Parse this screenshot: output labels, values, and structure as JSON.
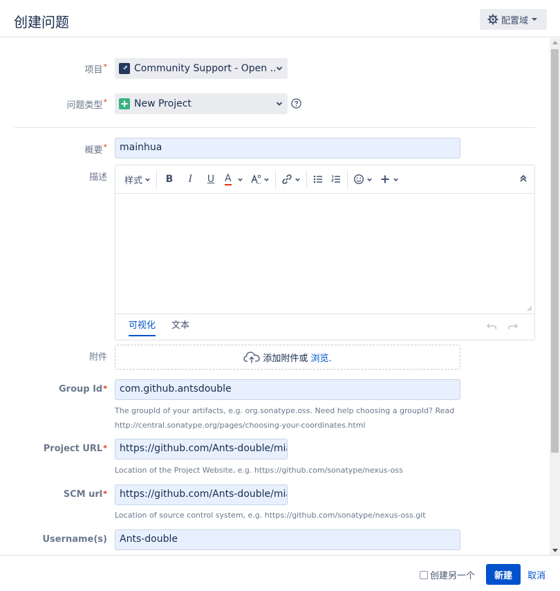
{
  "dialog": {
    "title": "创建问题",
    "config_label": "配置域"
  },
  "form": {
    "project": {
      "label": "项目",
      "value": "Community Support - Open ..."
    },
    "issue_type": {
      "label": "问题类型",
      "value": "New Project"
    },
    "summary": {
      "label": "概要",
      "value": "mainhua"
    },
    "description": {
      "label": "描述",
      "toolbar": {
        "style_label": "样式",
        "bold": "B",
        "italic": "I",
        "underline": "U",
        "color": "A"
      },
      "tabs": [
        "可视化",
        "文本"
      ]
    },
    "attachment": {
      "label": "附件",
      "drop_text": "添加附件或",
      "browse_link": "浏览."
    },
    "group_id": {
      "label": "Group Id",
      "value": "com.github.antsdouble",
      "help_line1": "The groupId of your artifacts, e.g. org.sonatype.oss. Need help choosing a groupId? Read",
      "help_line2": "http://central.sonatype.org/pages/choosing-your-coordinates.html"
    },
    "project_url": {
      "label": "Project URL",
      "value": "https://github.com/Ants-double/mianh",
      "help": "Location of the Project Website, e.g. https://github.com/sonatype/nexus-oss"
    },
    "scm_url": {
      "label": "SCM url",
      "value": "https://github.com/Ants-double/mianh",
      "help": "Location of source control system, e.g. https://github.com/sonatype/nexus-oss.git"
    },
    "usernames": {
      "label": "Username(s)",
      "value": "Ants-double"
    },
    "required_mark": "*"
  },
  "footer": {
    "create_another": "创建另一个",
    "create_button": "新建",
    "cancel_link": "取消"
  },
  "colors": {
    "primary": "#0052cc",
    "required": "#de350b",
    "input_fill": "#e8f0fe",
    "select_fill": "#ebecf0"
  }
}
